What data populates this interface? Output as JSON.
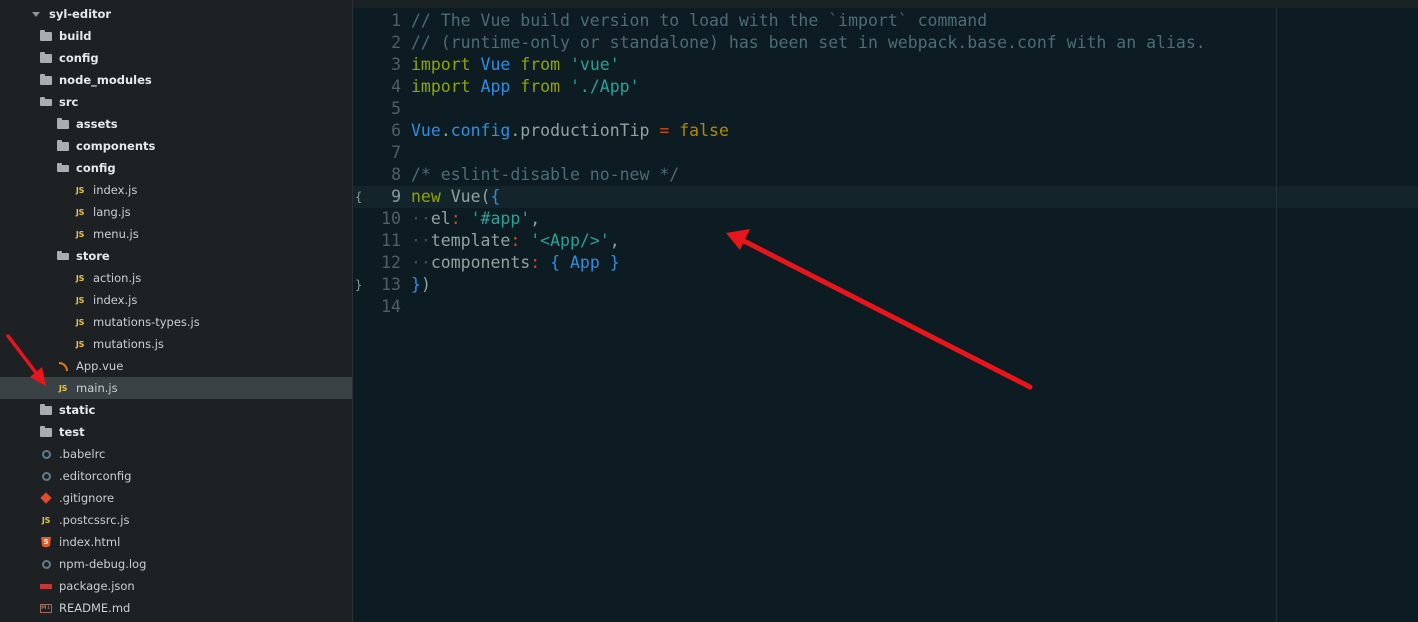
{
  "sidebar": {
    "items": [
      {
        "label": "syl-editor",
        "kind": "root",
        "depth": 0,
        "icon": "chevron-down-icon"
      },
      {
        "label": "build",
        "kind": "folder",
        "depth": 1,
        "icon": "folder-icon"
      },
      {
        "label": "config",
        "kind": "folder",
        "depth": 1,
        "icon": "folder-icon"
      },
      {
        "label": "node_modules",
        "kind": "folder",
        "depth": 1,
        "icon": "folder-icon"
      },
      {
        "label": "src",
        "kind": "folder-open",
        "depth": 1,
        "icon": "folder-open-icon"
      },
      {
        "label": "assets",
        "kind": "folder",
        "depth": 2,
        "icon": "folder-icon"
      },
      {
        "label": "components",
        "kind": "folder",
        "depth": 2,
        "icon": "folder-icon"
      },
      {
        "label": "config",
        "kind": "folder-open",
        "depth": 2,
        "icon": "folder-open-icon"
      },
      {
        "label": "index.js",
        "kind": "js",
        "depth": 3,
        "icon": "js-file-icon"
      },
      {
        "label": "lang.js",
        "kind": "js",
        "depth": 3,
        "icon": "js-file-icon"
      },
      {
        "label": "menu.js",
        "kind": "js",
        "depth": 3,
        "icon": "js-file-icon"
      },
      {
        "label": "store",
        "kind": "folder-open",
        "depth": 2,
        "icon": "folder-open-icon"
      },
      {
        "label": "action.js",
        "kind": "js",
        "depth": 3,
        "icon": "js-file-icon"
      },
      {
        "label": "index.js",
        "kind": "js",
        "depth": 3,
        "icon": "js-file-icon"
      },
      {
        "label": "mutations-types.js",
        "kind": "js",
        "depth": 3,
        "icon": "js-file-icon"
      },
      {
        "label": "mutations.js",
        "kind": "js",
        "depth": 3,
        "icon": "js-file-icon"
      },
      {
        "label": "App.vue",
        "kind": "vue",
        "depth": 2,
        "icon": "vue-file-icon"
      },
      {
        "label": "main.js",
        "kind": "js",
        "depth": 2,
        "icon": "js-file-icon",
        "selected": true
      },
      {
        "label": "static",
        "kind": "folder",
        "depth": 1,
        "icon": "folder-icon"
      },
      {
        "label": "test",
        "kind": "folder",
        "depth": 1,
        "icon": "folder-icon"
      },
      {
        "label": ".babelrc",
        "kind": "config",
        "depth": 1,
        "icon": "gear-icon"
      },
      {
        "label": ".editorconfig",
        "kind": "config",
        "depth": 1,
        "icon": "gear-icon"
      },
      {
        "label": ".gitignore",
        "kind": "git",
        "depth": 1,
        "icon": "git-icon"
      },
      {
        "label": ".postcssrc.js",
        "kind": "js",
        "depth": 1,
        "icon": "js-file-icon"
      },
      {
        "label": "index.html",
        "kind": "html",
        "depth": 1,
        "icon": "html5-icon"
      },
      {
        "label": "npm-debug.log",
        "kind": "config",
        "depth": 1,
        "icon": "gear-icon"
      },
      {
        "label": "package.json",
        "kind": "npm",
        "depth": 1,
        "icon": "npm-icon"
      },
      {
        "label": "README.md",
        "kind": "md",
        "depth": 1,
        "icon": "markdown-icon"
      }
    ]
  },
  "editor": {
    "active_line": 9,
    "fold_lines": {
      "9": "{",
      "13": "}"
    },
    "lines": [
      [
        [
          "c-comment",
          "// The Vue build version to load with the `import` command"
        ]
      ],
      [
        [
          "c-comment",
          "// (runtime-only or standalone) has been set in webpack.base.conf with an alias."
        ]
      ],
      [
        [
          "c-kw",
          "import"
        ],
        [
          "c-plain",
          " "
        ],
        [
          "c-name",
          "Vue"
        ],
        [
          "c-plain",
          " "
        ],
        [
          "c-kw",
          "from"
        ],
        [
          "c-plain",
          " "
        ],
        [
          "c-str",
          "'vue'"
        ]
      ],
      [
        [
          "c-kw",
          "import"
        ],
        [
          "c-plain",
          " "
        ],
        [
          "c-name",
          "App"
        ],
        [
          "c-plain",
          " "
        ],
        [
          "c-kw",
          "from"
        ],
        [
          "c-plain",
          " "
        ],
        [
          "c-str",
          "'./App'"
        ]
      ],
      [],
      [
        [
          "c-name",
          "Vue"
        ],
        [
          "c-plain",
          "."
        ],
        [
          "c-name",
          "config"
        ],
        [
          "c-plain",
          ".productionTip "
        ],
        [
          "c-op",
          "="
        ],
        [
          "c-plain",
          " "
        ],
        [
          "c-bool",
          "false"
        ]
      ],
      [],
      [
        [
          "c-comment",
          "/* eslint-disable no-new */"
        ]
      ],
      [
        [
          "c-kw",
          "new"
        ],
        [
          "c-plain",
          " Vue("
        ],
        [
          "c-name",
          "{"
        ]
      ],
      [
        [
          "c-dot",
          "··"
        ],
        [
          "c-plain",
          "el"
        ],
        [
          "c-op",
          ":"
        ],
        [
          "c-plain",
          " "
        ],
        [
          "c-str",
          "'#app'"
        ],
        [
          "c-plain",
          ","
        ]
      ],
      [
        [
          "c-dot",
          "··"
        ],
        [
          "c-plain",
          "template"
        ],
        [
          "c-op",
          ":"
        ],
        [
          "c-plain",
          " "
        ],
        [
          "c-str",
          "'<App/>'"
        ],
        [
          "c-plain",
          ","
        ]
      ],
      [
        [
          "c-dot",
          "··"
        ],
        [
          "c-plain",
          "components"
        ],
        [
          "c-op",
          ":"
        ],
        [
          "c-plain",
          " "
        ],
        [
          "c-name",
          "{ App }"
        ]
      ],
      [
        [
          "c-name",
          "}"
        ],
        [
          "c-plain",
          ")"
        ]
      ],
      []
    ]
  },
  "annotations": {
    "color": "#e8161b"
  }
}
